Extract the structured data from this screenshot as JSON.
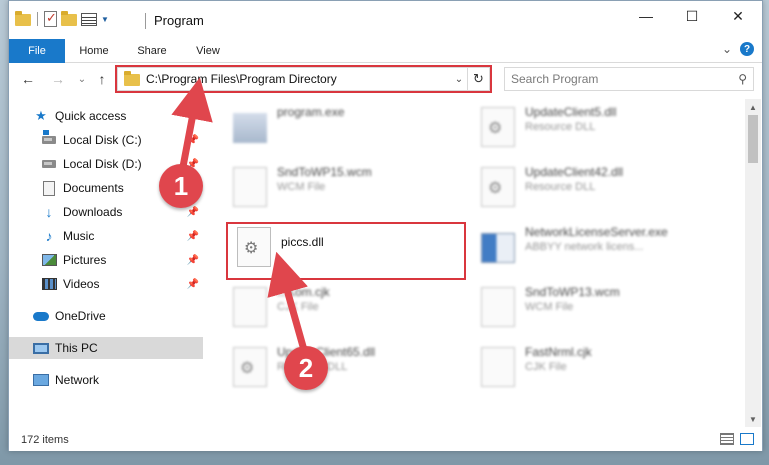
{
  "window": {
    "title": "Program",
    "minimize": "—",
    "maximize": "☐",
    "close": "✕"
  },
  "ribbon": {
    "tabs": [
      "File",
      "Home",
      "Share",
      "View"
    ],
    "collapse": "⌄",
    "help": "?"
  },
  "navigation": {
    "back": "←",
    "forward": "→",
    "recent": "⌄",
    "up": "↑",
    "address": "C:\\Program Files\\Program Directory",
    "address_dropdown": "⌄",
    "refresh": "↻",
    "search_placeholder": "Search Program",
    "search_icon": "⚲"
  },
  "sidebar": {
    "items": [
      {
        "label": "Quick access",
        "icon": "star-icon",
        "pinned": false
      },
      {
        "label": "Local Disk (C:)",
        "icon": "disk-icon",
        "pinned": true
      },
      {
        "label": "Local Disk (D:)",
        "icon": "disk-icon",
        "pinned": true
      },
      {
        "label": "Documents",
        "icon": "document-icon",
        "pinned": true
      },
      {
        "label": "Downloads",
        "icon": "download-icon",
        "pinned": true
      },
      {
        "label": "Music",
        "icon": "music-icon",
        "pinned": true
      },
      {
        "label": "Pictures",
        "icon": "pictures-icon",
        "pinned": true
      },
      {
        "label": "Videos",
        "icon": "videos-icon",
        "pinned": true
      },
      {
        "label": "OneDrive",
        "icon": "cloud-icon",
        "pinned": false
      },
      {
        "label": "This PC",
        "icon": "computer-icon",
        "pinned": false,
        "selected": true
      },
      {
        "label": "Network",
        "icon": "network-icon",
        "pinned": false
      }
    ],
    "pin_glyph": "📌"
  },
  "files": [
    {
      "name": "program.exe",
      "type": "",
      "icon": "exe-icon"
    },
    {
      "name": "UpdateClient5.dll",
      "type": "Resource DLL",
      "icon": "gear-file-icon"
    },
    {
      "name": "SndToWP15.wcm",
      "type": "WCM File",
      "icon": "blank-file-icon"
    },
    {
      "name": "UpdateClient42.dll",
      "type": "Resource DLL",
      "icon": "gear-file-icon"
    },
    {
      "name": "piccs.dll",
      "type": "",
      "icon": "gear-file-icon"
    },
    {
      "name": "NetworkLicenseServer.exe",
      "type": "ABBYY network licens...",
      "icon": "network-exe-icon"
    },
    {
      "name": "...Kom.cjk",
      "type": "CJK File",
      "icon": "blank-file-icon"
    },
    {
      "name": "SndToWP13.wcm",
      "type": "WCM File",
      "icon": "blank-file-icon"
    },
    {
      "name": "UpdateClient65.dll",
      "type": "Resource DLL",
      "icon": "gear-file-icon"
    },
    {
      "name": "FastNrml.cjk",
      "type": "CJK File",
      "icon": "blank-file-icon"
    }
  ],
  "status": {
    "item_count": "172 items"
  },
  "callouts": [
    "1",
    "2"
  ],
  "colors": {
    "accent": "#1979ca",
    "highlight": "#d9363e",
    "callout": "#e0464d"
  }
}
